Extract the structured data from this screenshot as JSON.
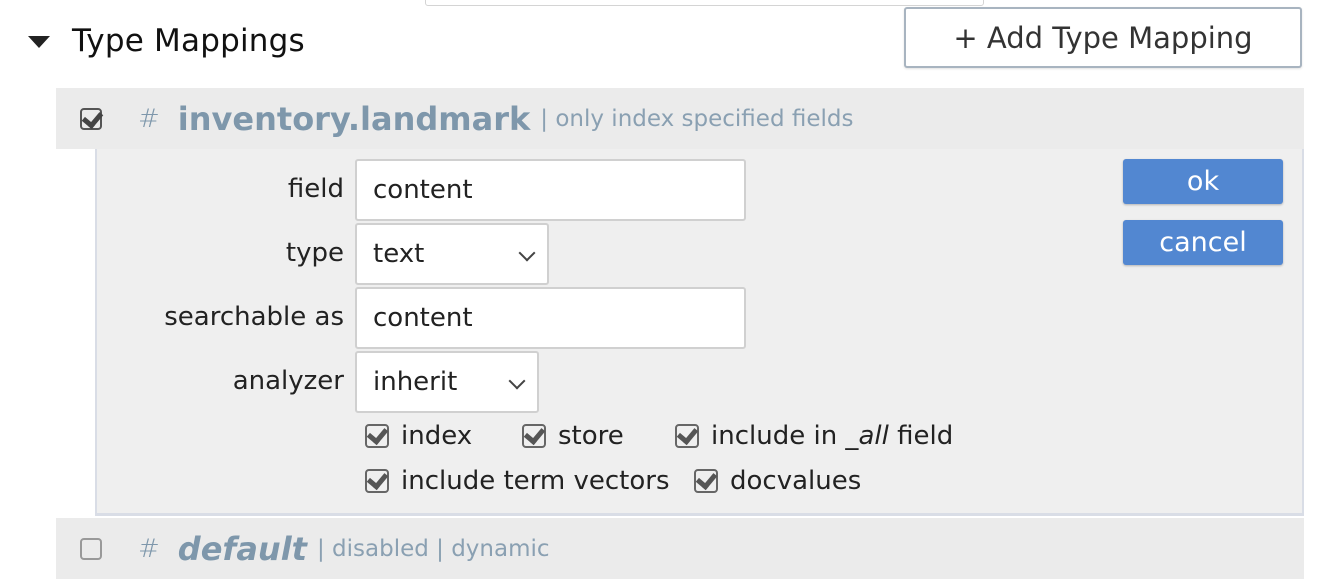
{
  "section": {
    "title": "Type Mappings",
    "expanded": true,
    "add_button_label": "+ Add Type Mapping"
  },
  "mappings": [
    {
      "enabled": true,
      "hash": "#",
      "name": "inventory.landmark",
      "description": "| only index specified fields"
    },
    {
      "enabled": false,
      "hash": "#",
      "name": "default",
      "description": "| disabled | dynamic"
    }
  ],
  "editor": {
    "field_label": "field",
    "field_value": "content",
    "type_label": "type",
    "type_value": "text",
    "searchable_label": "searchable as",
    "searchable_value": "content",
    "analyzer_label": "analyzer",
    "analyzer_value": "inherit",
    "ok_label": "ok",
    "cancel_label": "cancel",
    "options": {
      "index": {
        "label": "index",
        "checked": true
      },
      "store": {
        "label": "store",
        "checked": true
      },
      "include_all_prefix": "include in _",
      "include_all_em": "all",
      "include_all_suffix": " field",
      "include_all_checked": true,
      "term_vectors": {
        "label": "include term vectors",
        "checked": true
      },
      "docvalues": {
        "label": "docvalues",
        "checked": true
      }
    }
  }
}
